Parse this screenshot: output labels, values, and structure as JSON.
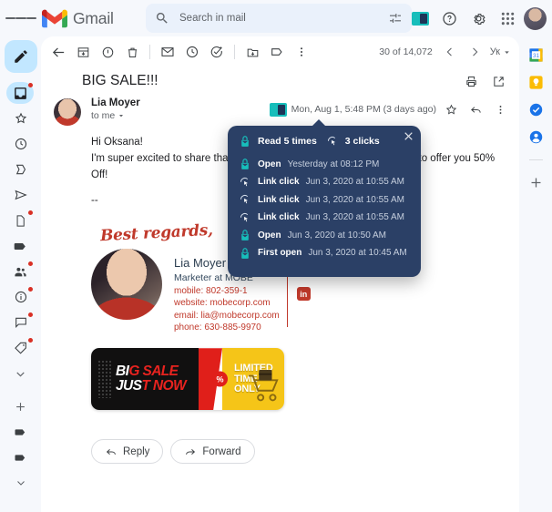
{
  "app": {
    "brand": "Gmail",
    "hamburger_label": "Main menu"
  },
  "search": {
    "placeholder": "Search in mail",
    "value": "",
    "search_icon": "search-icon",
    "filter_icon": "tune-filter-icon"
  },
  "header_actions": {
    "extension_label": "Mail tracking extension",
    "help_label": "Support",
    "settings_label": "Settings",
    "apps_label": "Google apps",
    "account_label": "Google Account"
  },
  "left_rail": {
    "compose_label": "Compose",
    "items": [
      {
        "name": "inbox",
        "label": "Inbox",
        "badge": true,
        "active": true
      },
      {
        "name": "starred",
        "label": "Starred",
        "badge": false,
        "active": false
      },
      {
        "name": "snoozed",
        "label": "Snoozed",
        "badge": false,
        "active": false
      },
      {
        "name": "important",
        "label": "Important",
        "badge": false,
        "active": false
      },
      {
        "name": "sent",
        "label": "Sent",
        "badge": false,
        "active": false
      },
      {
        "name": "drafts",
        "label": "Drafts",
        "badge": true,
        "active": false
      },
      {
        "name": "label-1",
        "label": "Label",
        "badge": false,
        "active": false
      },
      {
        "name": "groups",
        "label": "Groups",
        "badge": true,
        "active": false
      },
      {
        "name": "info",
        "label": "Info",
        "badge": true,
        "active": false
      },
      {
        "name": "chats",
        "label": "Chats",
        "badge": true,
        "active": false
      },
      {
        "name": "labels",
        "label": "Labels",
        "badge": true,
        "active": false
      }
    ],
    "more_label": "More",
    "add_label": "New label",
    "bottom_items": [
      {
        "name": "label-a",
        "label": "Label A"
      },
      {
        "name": "label-b",
        "label": "Label B"
      }
    ],
    "bottom_more_label": "Expand"
  },
  "right_rail": {
    "items": [
      {
        "name": "calendar",
        "label": "Calendar"
      },
      {
        "name": "keep",
        "label": "Keep"
      },
      {
        "name": "tasks",
        "label": "Tasks"
      },
      {
        "name": "contacts",
        "label": "Contacts"
      }
    ],
    "add_label": "Get add-ons"
  },
  "toolbar": {
    "back_label": "Back to Inbox",
    "archive_label": "Archive",
    "report_spam_label": "Report spam",
    "delete_label": "Delete",
    "mark_unread_label": "Mark as unread",
    "snooze_label": "Snooze",
    "add_to_tasks_label": "Add to Tasks",
    "move_to_label": "Move to",
    "labels_label": "Labels",
    "more_label": "More",
    "pager_count": "30 of 14,072",
    "prev_label": "Newer",
    "next_label": "Older",
    "language_label": "Ук"
  },
  "message": {
    "subject": "BIG SALE!!!",
    "print_label": "Print all",
    "open_new_label": "Open in new window",
    "sender_name": "Lia Moyer",
    "recipient": "to me",
    "date": "Mon, Aug 1, 5:48 PM (3 days ago)",
    "star_label": "Not starred",
    "reply_label": "Reply",
    "more_label": "More",
    "tracking_badge_label": "Tracking status",
    "body": {
      "greeting": "Hi Oksana!",
      "line_1": "I'm super excited to share that our holiday sale is live — we are happy to offer you 50% Off!",
      "separator": "--"
    }
  },
  "signature": {
    "best_regards": "Best regards,",
    "name": "Lia Moyer",
    "role": "Marketer at MOBE",
    "mobile_label": "mobile:",
    "mobile": "802-359-1",
    "website_label": "website:",
    "website": "mobecorp.com",
    "email_label": "email:",
    "email": "lia@mobecorp.com",
    "phone_label": "phone:",
    "phone": "630-885-9970",
    "linkedin": "in"
  },
  "banner": {
    "line1_a": "BI",
    "line1_b": "G SALE",
    "line2_a": "JUS",
    "line2_b": "T NOW",
    "badge": "%",
    "limited_line1": "LIMITED",
    "limited_line2": "TIME ONLY",
    "alt": "Big sale just now - limited time only"
  },
  "actions": {
    "reply": "Reply",
    "forward": "Forward"
  },
  "tracking_popup": {
    "close_label": "Close",
    "reads_icon": "open-envelope-icon",
    "reads": "Read 5 times",
    "clicks_icon": "click-cursor-icon",
    "clicks": "3 clicks",
    "events": [
      {
        "icon": "open-envelope-icon",
        "label": "Open",
        "time": "Yesterday at 08:12 PM"
      },
      {
        "icon": "click-cursor-icon",
        "label": "Link click",
        "time": "Jun 3, 2020 at 10:55 AM"
      },
      {
        "icon": "click-cursor-icon",
        "label": "Link click",
        "time": "Jun 3, 2020 at 10:55 AM"
      },
      {
        "icon": "click-cursor-icon",
        "label": "Link click",
        "time": "Jun 3, 2020 at 10:55 AM"
      },
      {
        "icon": "open-envelope-icon",
        "label": "Open",
        "time": "Jun 3, 2020 at 10:50 AM"
      },
      {
        "icon": "open-envelope-icon",
        "label": "First open",
        "time": "Jun 3, 2020 at 10:45 AM"
      }
    ]
  },
  "colors": {
    "popup_bg": "#2b4066",
    "accent_teal": "#17bebb",
    "gmail_red": "#ea4335",
    "badge_red": "#d93025",
    "chip_blue": "#c2e7ff",
    "signature_red": "#c0392b"
  }
}
